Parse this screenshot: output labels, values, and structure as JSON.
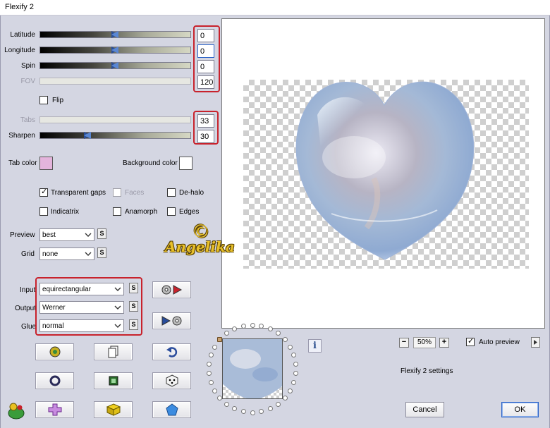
{
  "window": {
    "title": "Flexify 2"
  },
  "sliders": {
    "latitude": {
      "label": "Latitude",
      "value": "0"
    },
    "longitude": {
      "label": "Longitude",
      "value": "0"
    },
    "spin": {
      "label": "Spin",
      "value": "0"
    },
    "fov": {
      "label": "FOV",
      "value": "120"
    },
    "tabs": {
      "label": "Tabs",
      "value": "33"
    },
    "sharpen": {
      "label": "Sharpen",
      "value": "30"
    }
  },
  "flip": {
    "label": "Flip",
    "checked": false
  },
  "colors": {
    "tab_color": {
      "label": "Tab color",
      "value": "#e4b4dc"
    },
    "background_color": {
      "label": "Background color",
      "value": "#ffffff"
    },
    "highlight": "#c8222c"
  },
  "options": {
    "transparent_gaps": {
      "label": "Transparent gaps",
      "checked": true
    },
    "faces": {
      "label": "Faces",
      "checked": false,
      "enabled": false
    },
    "de_halo": {
      "label": "De-halo",
      "checked": false
    },
    "indicatrix": {
      "label": "Indicatrix",
      "checked": false
    },
    "anamorph": {
      "label": "Anamorph",
      "checked": false
    },
    "edges": {
      "label": "Edges",
      "checked": false
    }
  },
  "dropdowns": {
    "preview": {
      "label": "Preview",
      "value": "best"
    },
    "grid": {
      "label": "Grid",
      "value": "none"
    },
    "input": {
      "label": "Input",
      "value": "equirectangular"
    },
    "output": {
      "label": "Output",
      "value": "Werner"
    },
    "glue": {
      "label": "Glue",
      "value": "normal"
    },
    "s_button": "S"
  },
  "watermark": {
    "text": "Angelika",
    "symbol": "©"
  },
  "zoom": {
    "minus": "−",
    "value": "50%",
    "plus": "+"
  },
  "auto_preview": {
    "label": "Auto preview",
    "checked": true
  },
  "settings_label": "Flexify 2 settings",
  "info_label": "i",
  "buttons": {
    "cancel": "Cancel",
    "ok": "OK"
  }
}
